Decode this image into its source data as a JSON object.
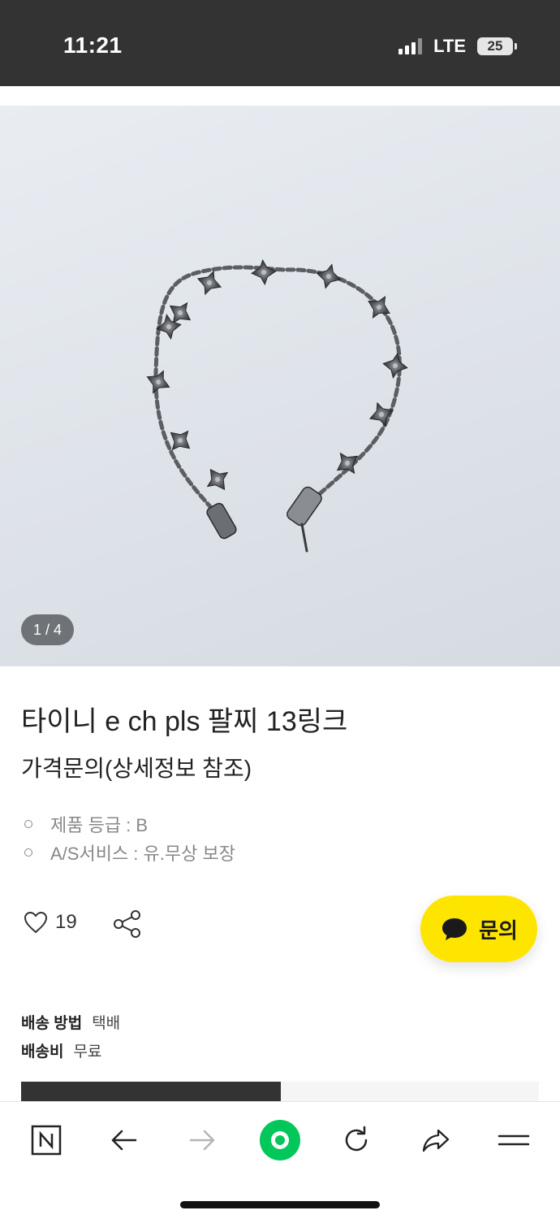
{
  "status_bar": {
    "time": "11:21",
    "network": "LTE",
    "battery": "25"
  },
  "gallery": {
    "counter": "1 / 4",
    "current": 1,
    "total": 4
  },
  "product": {
    "title": "타이니 e ch pls 팔찌 13링크",
    "price": "가격문의(상세정보 참조)",
    "specs": [
      "제품 등급 : B",
      "A/S서비스 :  유.무상 보장"
    ]
  },
  "actions": {
    "like_count": "19",
    "inquiry_label": "문의"
  },
  "shipping": {
    "method_label": "배송 방법",
    "method_value": "택배",
    "fee_label": "배송비",
    "fee_value": "무료"
  },
  "colors": {
    "inquiry_button": "#fee500",
    "browser_logo": "#03c75a",
    "status_bar": "#333333"
  },
  "browser_nav": [
    "naver-n-icon",
    "back-arrow-icon",
    "forward-arrow-icon",
    "naver-green-dot-icon",
    "reload-icon",
    "share-icon",
    "menu-icon"
  ]
}
